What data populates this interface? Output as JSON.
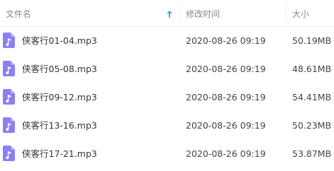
{
  "header": {
    "name_label": "文件名",
    "date_label": "修改时间",
    "size_label": "大小",
    "sort_icon": "sort-ascending-arrow",
    "sort_color": "#3fa6e8"
  },
  "file_icon": {
    "name": "music-file-icon",
    "color": "#8c7ff2"
  },
  "files": [
    {
      "name": "侠客行01-04.mp3",
      "modified": "2020-08-26 09:19",
      "size": "50.19MB"
    },
    {
      "name": "侠客行05-08.mp3",
      "modified": "2020-08-26 09:19",
      "size": "48.61MB"
    },
    {
      "name": "侠客行09-12.mp3",
      "modified": "2020-08-26 09:19",
      "size": "54.41MB"
    },
    {
      "name": "侠客行13-16.mp3",
      "modified": "2020-08-26 09:19",
      "size": "50.23MB"
    },
    {
      "name": "侠客行17-21.mp3",
      "modified": "2020-08-26 09:19",
      "size": "53.87MB"
    }
  ]
}
